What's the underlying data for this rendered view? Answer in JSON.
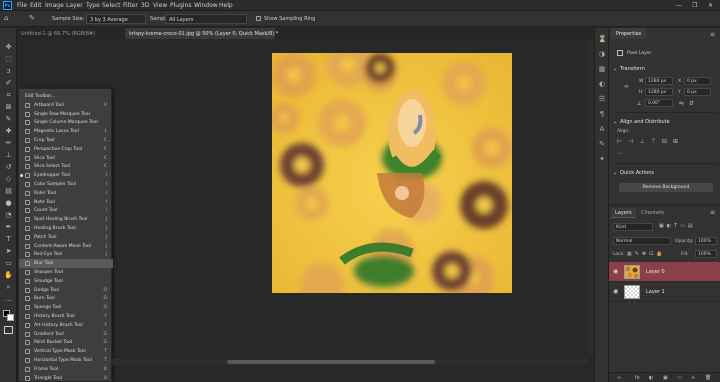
{
  "app": {
    "logo": "Ps",
    "accent": "#31a8ff"
  },
  "menu": [
    "File",
    "Edit",
    "Image",
    "Layer",
    "Type",
    "Select",
    "Filter",
    "3D",
    "View",
    "Plugins",
    "Window",
    "Help"
  ],
  "window_controls": [
    "—",
    "❐",
    "✕"
  ],
  "options": {
    "sample_size_label": "Sample Size:",
    "sample_size_value": "3 by 3 Average",
    "sample_label": "Sample:",
    "sample_value": "All Layers",
    "show_ring_label": "Show Sampling Ring"
  },
  "tabs": [
    {
      "label": "Untitled-1 @ 66.7% (RGB/8#)",
      "active": false
    },
    {
      "label": "krispy-kreme-crocs-01.jpg @ 50% (Layer 0, Quick Mask/8) *",
      "active": true
    }
  ],
  "toolbar_icons": [
    "move-icon",
    "marquee-icon",
    "lasso-icon",
    "quick-select-icon",
    "crop-icon",
    "frame-icon",
    "eyedropper-icon",
    "healing-icon",
    "brush-icon",
    "stamp-icon",
    "history-brush-icon",
    "eraser-icon",
    "gradient-icon",
    "blur-icon",
    "dodge-icon",
    "pen-icon",
    "type-icon",
    "path-select-icon",
    "shape-icon",
    "hand-icon",
    "zoom-icon",
    "more-icon"
  ],
  "flyout": [
    {
      "label": "Edit Toolbar...",
      "shortcut": "",
      "hl": false,
      "dot": false
    },
    {
      "label": "Artboard Tool",
      "shortcut": "V",
      "hl": false,
      "dot": false
    },
    {
      "label": "Single Row Marquee Tool",
      "shortcut": "",
      "hl": false,
      "dot": false
    },
    {
      "label": "Single Column Marquee Tool",
      "shortcut": "",
      "hl": false,
      "dot": false
    },
    {
      "label": "Magnetic Lasso Tool",
      "shortcut": "L",
      "hl": false,
      "dot": false
    },
    {
      "label": "Crop Tool",
      "shortcut": "C",
      "hl": false,
      "dot": false
    },
    {
      "label": "Perspective Crop Tool",
      "shortcut": "C",
      "hl": false,
      "dot": false
    },
    {
      "label": "Slice Tool",
      "shortcut": "C",
      "hl": false,
      "dot": false
    },
    {
      "label": "Slice Select Tool",
      "shortcut": "C",
      "hl": false,
      "dot": false
    },
    {
      "label": "Eyedropper Tool",
      "shortcut": "I",
      "hl": false,
      "dot": true
    },
    {
      "label": "Color Sampler Tool",
      "shortcut": "I",
      "hl": false,
      "dot": false
    },
    {
      "label": "Ruler Tool",
      "shortcut": "I",
      "hl": false,
      "dot": false
    },
    {
      "label": "Note Tool",
      "shortcut": "I",
      "hl": false,
      "dot": false
    },
    {
      "label": "Count Tool",
      "shortcut": "I",
      "hl": false,
      "dot": false
    },
    {
      "label": "Spot Healing Brush Tool",
      "shortcut": "J",
      "hl": false,
      "dot": false
    },
    {
      "label": "Healing Brush Tool",
      "shortcut": "J",
      "hl": false,
      "dot": false
    },
    {
      "label": "Patch Tool",
      "shortcut": "J",
      "hl": false,
      "dot": false
    },
    {
      "label": "Content-Aware Move Tool",
      "shortcut": "J",
      "hl": false,
      "dot": false
    },
    {
      "label": "Red Eye Tool",
      "shortcut": "J",
      "hl": false,
      "dot": false
    },
    {
      "label": "Blur Tool",
      "shortcut": "",
      "hl": true,
      "dot": false
    },
    {
      "label": "Sharpen Tool",
      "shortcut": "",
      "hl": false,
      "dot": false
    },
    {
      "label": "Smudge Tool",
      "shortcut": "",
      "hl": false,
      "dot": false
    },
    {
      "label": "Dodge Tool",
      "shortcut": "O",
      "hl": false,
      "dot": false
    },
    {
      "label": "Burn Tool",
      "shortcut": "O",
      "hl": false,
      "dot": false
    },
    {
      "label": "Sponge Tool",
      "shortcut": "O",
      "hl": false,
      "dot": false
    },
    {
      "label": "History Brush Tool",
      "shortcut": "Y",
      "hl": false,
      "dot": false
    },
    {
      "label": "Art History Brush Tool",
      "shortcut": "Y",
      "hl": false,
      "dot": false
    },
    {
      "label": "Gradient Tool",
      "shortcut": "G",
      "hl": false,
      "dot": false
    },
    {
      "label": "Paint Bucket Tool",
      "shortcut": "G",
      "hl": false,
      "dot": false
    },
    {
      "label": "Vertical Type Mask Tool",
      "shortcut": "T",
      "hl": false,
      "dot": false
    },
    {
      "label": "Horizontal Type Mask Tool",
      "shortcut": "T",
      "hl": false,
      "dot": false
    },
    {
      "label": "Frame Tool",
      "shortcut": "K",
      "hl": false,
      "dot": false
    },
    {
      "label": "Triangle Tool",
      "shortcut": "U",
      "hl": false,
      "dot": false
    }
  ],
  "properties": {
    "tab": "Properties",
    "type_label": "Pixel Layer",
    "transform_label": "Transform",
    "w_label": "W",
    "w_value": "1280 px",
    "h_label": "H",
    "h_value": "1280 px",
    "x_label": "X",
    "x_value": "0 px",
    "y_label": "Y",
    "y_value": "0 px",
    "angle_value": "0.00°",
    "align_label": "Align and Distribute",
    "align_sub": "Align:",
    "quick_label": "Quick Actions",
    "remove_bg": "Remove Background"
  },
  "layers": {
    "tab_layers": "Layers",
    "tab_channels": "Channels",
    "kind": "Kind",
    "blend": "Normal",
    "opacity_label": "Opacity:",
    "opacity_value": "100%",
    "lock_label": "Lock:",
    "fill_label": "Fill:",
    "fill_value": "100%",
    "rows": [
      {
        "name": "Layer 0",
        "selected": true
      },
      {
        "name": "Layer 1",
        "selected": false
      }
    ],
    "footer": [
      "fx",
      "◐",
      "▣",
      "▭",
      "+",
      "🗑"
    ]
  },
  "colors": {
    "selected_layer": "#8b4048",
    "canvas_bg": "#f0c441"
  }
}
